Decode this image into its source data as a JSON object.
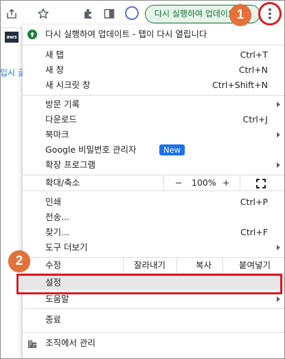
{
  "toolbar": {
    "update_button_label": "다시 실행하여 업데이트"
  },
  "page": {
    "logo_text": "aws",
    "cut_text": "입시 글"
  },
  "menu": {
    "update_item": "다시 실행하여 업데이트 - 탭이 다시 열립니다",
    "new_tab": {
      "label": "새 탭",
      "shortcut": "Ctrl+T"
    },
    "new_window": {
      "label": "새 창",
      "shortcut": "Ctrl+N"
    },
    "incognito": {
      "label": "새 시크릿 창",
      "shortcut": "Ctrl+Shift+N"
    },
    "history": {
      "label": "방문 기록"
    },
    "downloads": {
      "label": "다운로드",
      "shortcut": "Ctrl+J"
    },
    "bookmarks": {
      "label": "북마크"
    },
    "password_manager": {
      "label": "Google 비밀번호 관리자",
      "badge": "New"
    },
    "extensions": {
      "label": "확장 프로그램"
    },
    "zoom": {
      "label": "확대/축소",
      "minus": "−",
      "value": "100%",
      "plus": "+"
    },
    "print": {
      "label": "인쇄",
      "shortcut": "Ctrl+P"
    },
    "cast": {
      "label": "전송..."
    },
    "find": {
      "label": "찾기...",
      "shortcut": "Ctrl+F"
    },
    "more_tools": {
      "label": "도구 더보기"
    },
    "edit": {
      "label": "수정",
      "cut": "잘라내기",
      "copy": "복사",
      "paste": "붙여넣기"
    },
    "settings": {
      "label": "설정"
    },
    "help": {
      "label": "도움말"
    },
    "exit": {
      "label": "종료"
    },
    "managed": {
      "label": "조직에서 관리"
    }
  },
  "annotations": {
    "step1": "1",
    "step2": "2",
    "accent_color": "#e4703a",
    "highlight_color": "#e0171f"
  }
}
